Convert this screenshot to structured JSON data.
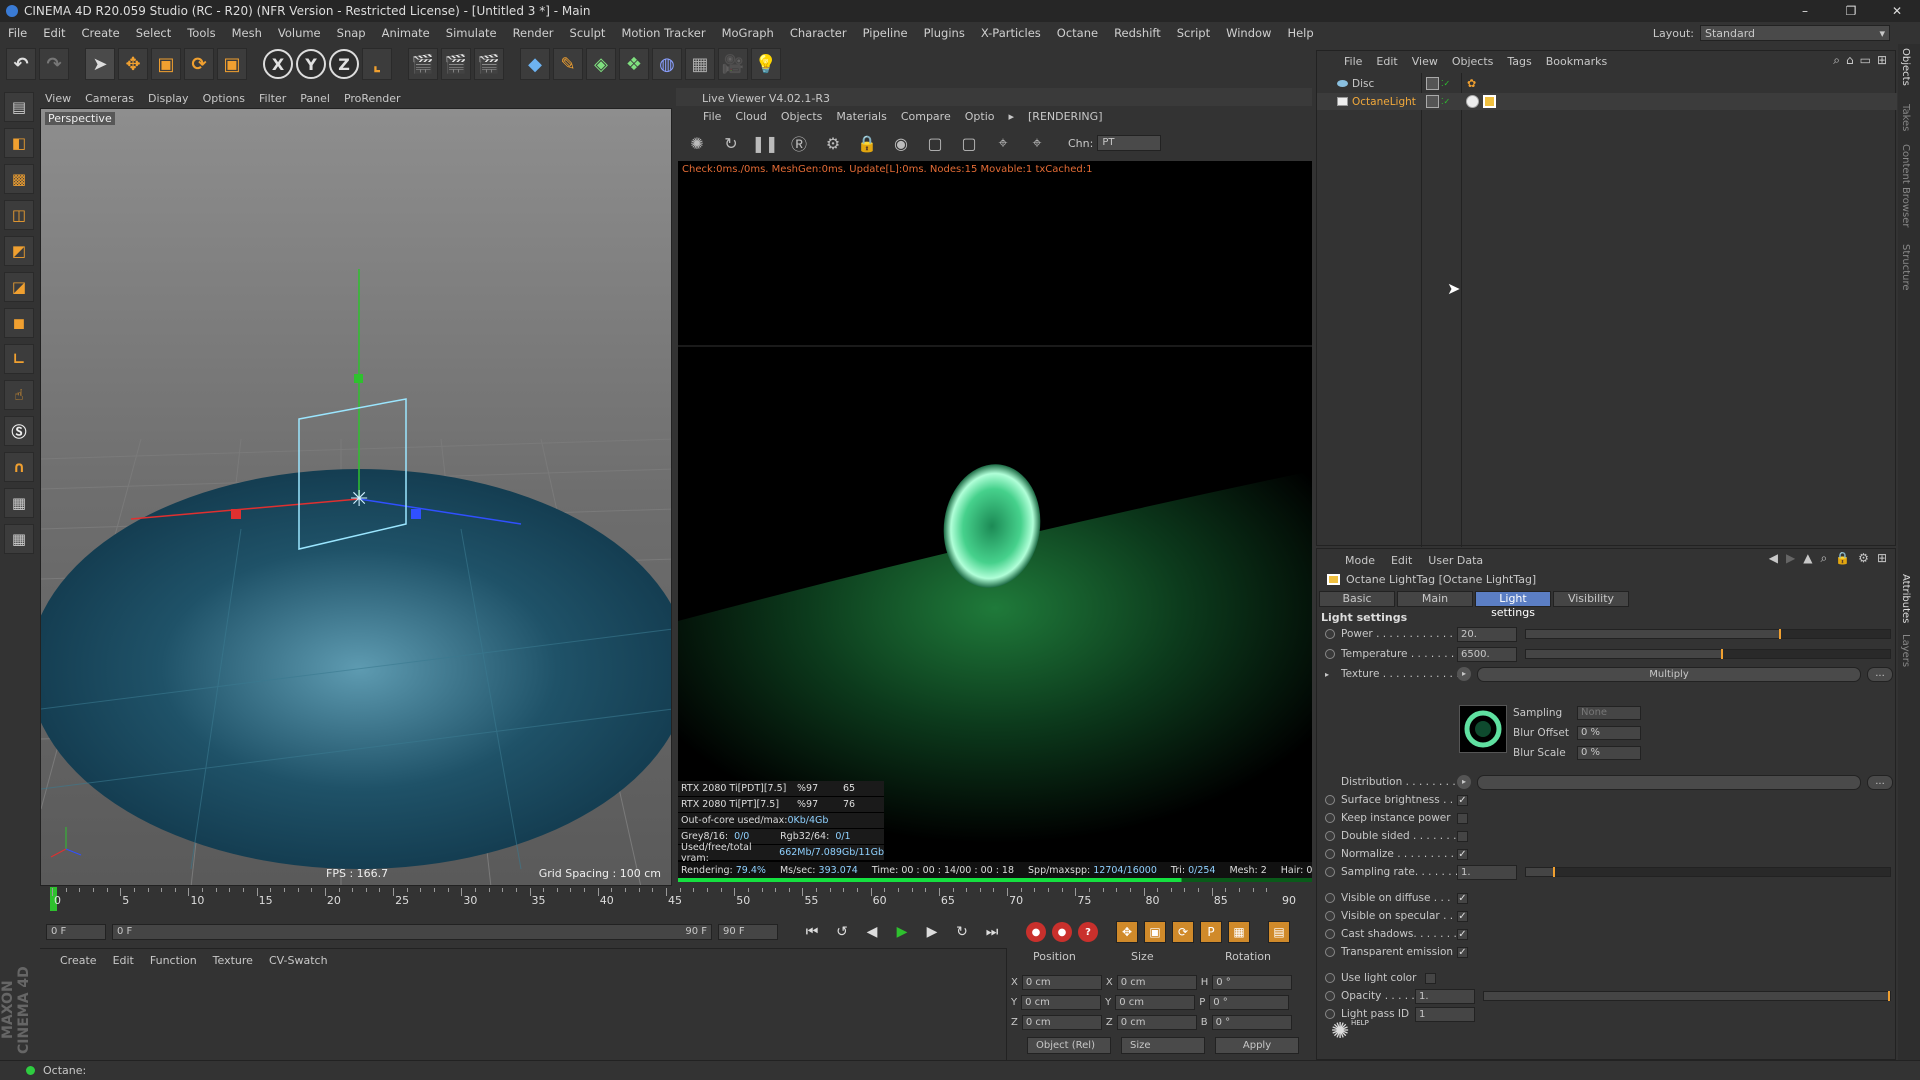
{
  "titlebar": {
    "title": "CINEMA 4D R20.059 Studio (RC - R20) (NFR Version - Restricted License) - [Untitled 3 *] - Main",
    "minimize": "–",
    "restore": "❐",
    "close": "✕"
  },
  "menubar": [
    "File",
    "Edit",
    "Create",
    "Select",
    "Tools",
    "Mesh",
    "Volume",
    "Snap",
    "Animate",
    "Simulate",
    "Render",
    "Sculpt",
    "Motion Tracker",
    "MoGraph",
    "Character",
    "Pipeline",
    "Plugins",
    "X-Particles",
    "Octane",
    "Redshift",
    "Script",
    "Window",
    "Help"
  ],
  "layout": {
    "label": "Layout:",
    "value": "Standard"
  },
  "toolbar_icons": [
    "undo-icon",
    "redo-icon",
    "select-arrow-icon",
    "move-icon",
    "scale-icon",
    "rotate-icon",
    "recent-tool-icon",
    "x-axis-icon",
    "y-axis-icon",
    "z-axis-icon",
    "coordinate-system-icon",
    "render-view-icon",
    "render-picture-viewer-icon",
    "render-settings-icon",
    "cube-icon",
    "pen-spline-icon",
    "subdivision-icon",
    "array-icon",
    "deformer-icon",
    "floor-icon",
    "camera-icon",
    "light-icon"
  ],
  "toolbar_labels": {
    "x": "X",
    "y": "Y",
    "z": "Z"
  },
  "viewport": {
    "menu": [
      "View",
      "Cameras",
      "Display",
      "Options",
      "Filter",
      "Panel",
      "ProRender"
    ],
    "label": "Perspective",
    "fps": "FPS : 166.7",
    "grid_spacing": "Grid Spacing : 100 cm"
  },
  "live_viewer": {
    "title": "Live Viewer V4.02.1-R3",
    "menu": [
      "File",
      "Cloud",
      "Objects",
      "Materials",
      "Compare",
      "Optio",
      "▸",
      "[RENDERING]"
    ],
    "channel_label": "Chn:",
    "channel_value": "PT",
    "check_line": "Check:0ms./0ms. MeshGen:0ms. Update[L]:0ms. Nodes:15 Movable:1 txCached:1",
    "gpu_rows": [
      {
        "name": "RTX 2080 Ti[PDT][7.5]",
        "pct": "%97",
        "temp": "65"
      },
      {
        "name": "RTX 2080 Ti[PT][7.5]",
        "pct": "%97",
        "temp": "76"
      }
    ],
    "out_of_core": {
      "label": "Out-of-core used/max:",
      "value": "0Kb/4Gb"
    },
    "grey": {
      "label": "Grey8/16:",
      "value": "0/0",
      "label2": "Rgb32/64:",
      "value2": "0/1"
    },
    "vram": {
      "label": "Used/free/total vram:",
      "value": "662Mb/7.089Gb/11Gb"
    },
    "status": {
      "rendering_label": "Rendering:",
      "rendering_value": "79.4%",
      "mssec_label": "Ms/sec:",
      "mssec_value": "393.074",
      "time": "Time: 00 : 00 : 14/00 : 00 : 18",
      "spp_label": "Spp/maxspp:",
      "spp_value": "12704/16000",
      "tri_label": "Tri:",
      "tri_value": "0/254",
      "mesh": "Mesh: 2",
      "hair": "Hair: 0"
    },
    "progress": 0.794
  },
  "timeline": {
    "ticks": [
      "0",
      "5",
      "10",
      "15",
      "20",
      "25",
      "30",
      "35",
      "40",
      "45",
      "50",
      "55",
      "60",
      "65",
      "70",
      "75",
      "80",
      "85",
      "90"
    ],
    "current_frame_field": "0 F",
    "start_field": "0 F",
    "range_start": "0 F",
    "range_end": "90 F",
    "end_field": "90 F"
  },
  "material_menu": [
    "Create",
    "Edit",
    "Function",
    "Texture",
    "CV-Swatch"
  ],
  "coords": {
    "headers": [
      "Position",
      "Size",
      "Rotation"
    ],
    "rows": [
      {
        "axis": "X",
        "pos": "0 cm",
        "size_axis": "X",
        "size": "0 cm",
        "rot_axis": "H",
        "rot": "0 °"
      },
      {
        "axis": "Y",
        "pos": "0 cm",
        "size_axis": "Y",
        "size": "0 cm",
        "rot_axis": "P",
        "rot": "0 °"
      },
      {
        "axis": "Z",
        "pos": "0 cm",
        "size_axis": "Z",
        "size": "0 cm",
        "rot_axis": "B",
        "rot": "0 °"
      }
    ],
    "mode": "Object (Rel)",
    "size_mode": "Size",
    "apply": "Apply"
  },
  "statusbar": {
    "text": "Octane:"
  },
  "object_manager": {
    "menu": [
      "File",
      "Edit",
      "View",
      "Objects",
      "Tags",
      "Bookmarks"
    ],
    "objects": [
      {
        "name": "Disc",
        "selected": false
      },
      {
        "name": "OctaneLight",
        "selected": true
      }
    ]
  },
  "right_tabs": [
    "Objects",
    "Takes",
    "Content Browser",
    "Structure",
    "Attributes",
    "Layers"
  ],
  "attributes": {
    "menu": [
      "Mode",
      "Edit",
      "User Data"
    ],
    "tag_title": "Octane LightTag [Octane LightTag]",
    "tabs": [
      "Basic",
      "Main",
      "Light settings",
      "Visibility"
    ],
    "active_tab": "Light settings",
    "section": "Light settings",
    "power": {
      "label": "Power . . . . . . . . . . . . .",
      "value": "20.",
      "level": 0.7
    },
    "temperature": {
      "label": "Temperature . . . . . . . .",
      "value": "6500.",
      "level": 0.54
    },
    "texture": {
      "label": "Texture . . . . . . . . . . . .",
      "mode": "Multiply",
      "more": "..."
    },
    "sampling": {
      "label": "Sampling",
      "value": "None"
    },
    "blur_offset": {
      "label": "Blur Offset",
      "value": "0 %"
    },
    "blur_scale": {
      "label": "Blur Scale",
      "value": "0 %"
    },
    "distribution": {
      "label": "Distribution . . . . . . . .",
      "more": "..."
    },
    "checks": [
      {
        "label": "Surface brightness . .",
        "checked": true
      },
      {
        "label": "Keep instance power",
        "checked": false
      },
      {
        "label": "Double sided . . . . . . .",
        "checked": false
      },
      {
        "label": "Normalize . . . . . . . . . .",
        "checked": true
      }
    ],
    "sampling_rate": {
      "label": "Sampling rate. . . . . . . .",
      "value": "1.",
      "level": 0.08
    },
    "checks2": [
      {
        "label": "Visible on diffuse . . .",
        "checked": true
      },
      {
        "label": "Visible on specular . .",
        "checked": true
      },
      {
        "label": "Cast shadows. . . . . . . .",
        "checked": true
      },
      {
        "label": "Transparent emission",
        "checked": true
      }
    ],
    "use_light_color": {
      "label": "Use light color",
      "checked": false
    },
    "opacity": {
      "label": "Opacity . . . . .",
      "value": "1.",
      "level": 1.0
    },
    "light_pass": {
      "label": "Light pass ID",
      "value": "1"
    },
    "help": "HELP"
  },
  "colors": {
    "accent": "#f0a030",
    "tab_active": "#5b7ec4",
    "progress": "#15e040",
    "record": "#c9302c"
  }
}
